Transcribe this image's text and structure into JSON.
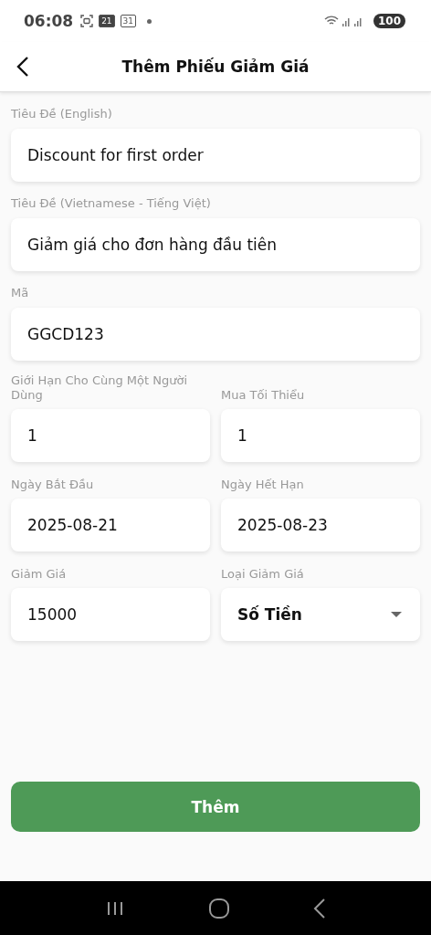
{
  "status_bar": {
    "time": "06:08",
    "calendar_badges": [
      "21",
      "31"
    ],
    "battery": "100"
  },
  "header": {
    "title": "Thêm Phiếu Giảm Giá"
  },
  "rows": [
    [
      {
        "kind": "text",
        "label": "Tiêu Đề (English)",
        "value": "Discount for first order"
      }
    ],
    [
      {
        "kind": "text",
        "label": "Tiêu Đề (Vietnamese - Tiếng Việt)",
        "value": "Giảm giá cho đơn hàng đầu tiên"
      }
    ],
    [
      {
        "kind": "text",
        "label": "Mã",
        "value": "GGCD123"
      }
    ],
    [
      {
        "kind": "text",
        "label": "Giới Hạn Cho Cùng Một Người Dùng",
        "value": "1"
      },
      {
        "kind": "text",
        "label": "Mua Tối Thiểu",
        "value": "1"
      }
    ],
    [
      {
        "kind": "text",
        "label": "Ngày Bắt Đầu",
        "value": "2025-08-21"
      },
      {
        "kind": "text",
        "label": "Ngày Hết Hạn",
        "value": "2025-08-23"
      }
    ],
    [
      {
        "kind": "text",
        "label": "Giảm Giá",
        "value": "15000"
      },
      {
        "kind": "select",
        "label": "Loại Giảm Giá",
        "value": "Số Tiền"
      }
    ]
  ],
  "submit": "Thêm"
}
